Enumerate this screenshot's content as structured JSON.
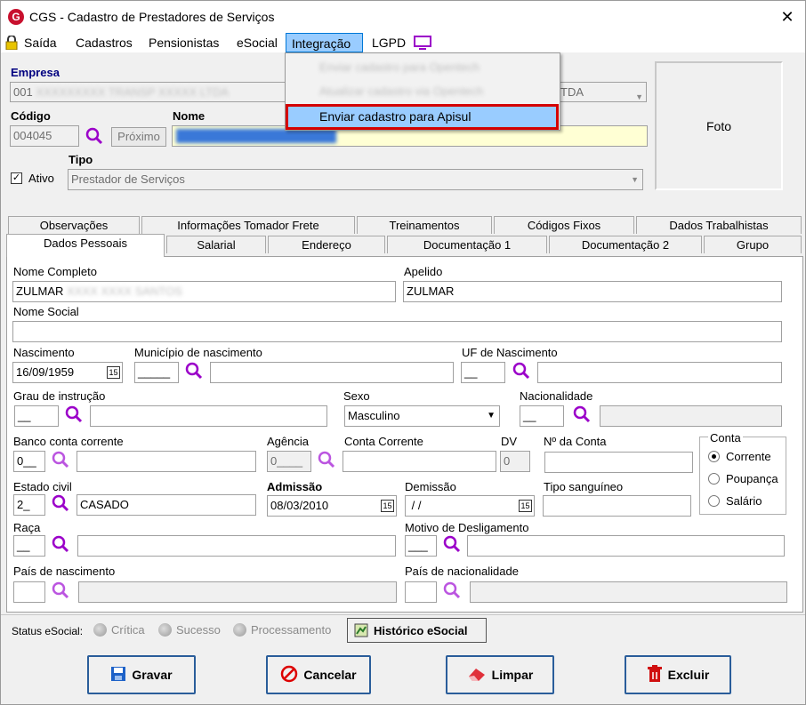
{
  "window": {
    "title": "CGS - Cadastro de Prestadores de Serviços",
    "close": "✕"
  },
  "menu": {
    "items": [
      "Saída",
      "Cadastros",
      "Pensionistas",
      "eSocial",
      "Integração",
      "LGPD"
    ]
  },
  "integracao_menu": {
    "items": [
      "Enviar cadastro para Opentech",
      "Atualizar cadastro via Opentech",
      "Enviar cadastro para Apisul"
    ]
  },
  "header": {
    "empresa_label": "Empresa",
    "empresa_value": "001",
    "empresa_suffix": "TDA",
    "codigo_label": "Código",
    "codigo_value": "004045",
    "proximo_button": "Próximo",
    "nome_label": "Nome",
    "ativo_label": "Ativo",
    "tipo_label": "Tipo",
    "tipo_value": "Prestador de Serviços",
    "foto_label": "Foto"
  },
  "tabs_top": [
    "Observações",
    "Informações Tomador Frete",
    "Treinamentos",
    "Códigos Fixos",
    "Dados Trabalhistas"
  ],
  "tabs_bottom": [
    "Dados Pessoais",
    "Salarial",
    "Endereço",
    "Documentação 1",
    "Documentação 2",
    "Grupo"
  ],
  "form": {
    "nome_completo_label": "Nome Completo",
    "nome_completo_value": "ZULMAR",
    "apelido_label": "Apelido",
    "apelido_value": "ZULMAR",
    "nome_social_label": "Nome Social",
    "nascimento_label": "Nascimento",
    "nascimento_value": "16/09/1959",
    "municipio_label": "Município de nascimento",
    "municipio_code": "_____",
    "uf_label": "UF de Nascimento",
    "uf_code": "__",
    "grau_label": "Grau de instrução",
    "grau_code": "__",
    "sexo_label": "Sexo",
    "sexo_value": "Masculino",
    "nacionalidade_label": "Nacionalidade",
    "nacionalidade_code": "__",
    "banco_label": "Banco conta corrente",
    "banco_code": "0__",
    "agencia_label": "Agência",
    "agencia_code": "0____",
    "conta_corrente_label": "Conta Corrente",
    "dv_label": "DV",
    "dv_value": "0",
    "num_conta_label": "Nº da Conta",
    "conta_group_label": "Conta",
    "conta_options": [
      "Corrente",
      "Poupança",
      "Salário"
    ],
    "estado_civil_label": "Estado civil",
    "estado_civil_code": "2_",
    "estado_civil_value": "CASADO",
    "admissao_label": "Admissão",
    "admissao_value": "08/03/2010",
    "demissao_label": "Demissão",
    "demissao_value": " / /",
    "tipo_sanguineo_label": "Tipo sanguíneo",
    "raca_label": "Raça",
    "raca_code": "__",
    "motivo_label": "Motivo de Desligamento",
    "motivo_code": "___",
    "pais_nasc_label": "País de nascimento",
    "pais_nac_label": "País de nacionalidade",
    "cal_icon": "15"
  },
  "status": {
    "label": "Status eSocial:",
    "options": [
      "Crítica",
      "Sucesso",
      "Processamento"
    ],
    "historico_button": "Histórico eSocial"
  },
  "actions": {
    "gravar": "Gravar",
    "cancelar": "Cancelar",
    "limpar": "Limpar",
    "excluir": "Excluir"
  },
  "colors": {
    "accent": "#0078d7",
    "highlight_border": "#d40000",
    "menu_highlight": "#99ccff",
    "purple_icon": "#9b00c9"
  }
}
